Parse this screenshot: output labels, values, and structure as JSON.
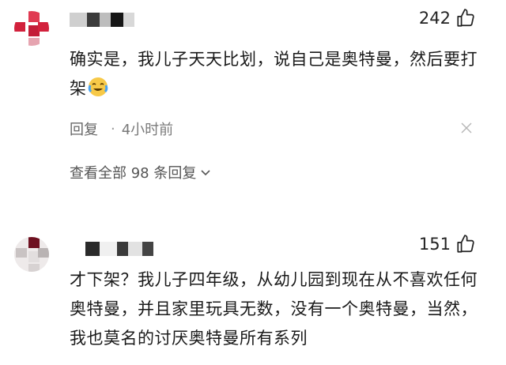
{
  "comments": [
    {
      "like_count": "242",
      "text": "确实是，我儿子天天比划，说自己是奥特曼，然后要打架",
      "emoji": "crying-laughing-emoji",
      "reply_label": "回复",
      "time": "4小时前",
      "view_all": "查看全部 98 条回复"
    },
    {
      "like_count": "151",
      "text": "才下架？我儿子四年级，从幼儿园到现在从不喜欢任何奥特曼，并且家里玩具无数，没有一个奥特曼，当然，我也莫名的讨厌奥特曼所有系列"
    }
  ],
  "icons": {
    "like": "thumbs-up-icon",
    "close": "close-icon",
    "expand": "chevron-down-icon"
  },
  "colors": {
    "avatar_red": "#d2213c",
    "text": "#1a1a1a",
    "meta": "#7a7a7a"
  }
}
